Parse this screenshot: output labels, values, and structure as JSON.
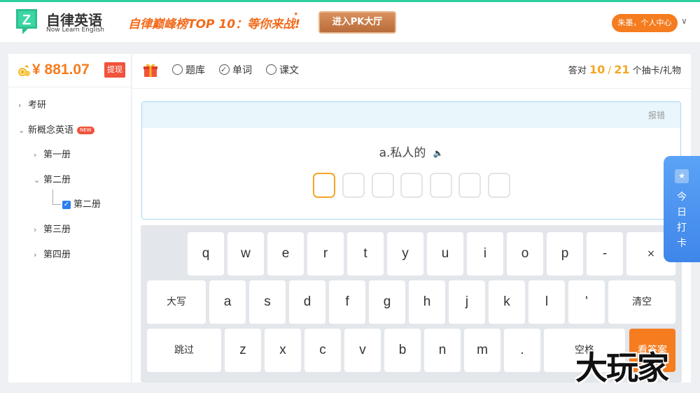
{
  "header": {
    "logo_letter": "Z",
    "logo_name": "自律英语",
    "logo_sub": "Now Learn English",
    "promo_text": "自律巅峰榜TOP 10：等你来战!",
    "promo_spark": "✦",
    "pk_button": "进入PK大厅",
    "user_button": "朱墨，个人中心",
    "user_arrow": "∨"
  },
  "sidebar": {
    "currency": "¥",
    "balance": "881.07",
    "withdraw": "提现",
    "tree": [
      {
        "label": "考研",
        "arrow": "›"
      },
      {
        "label": "新概念英语",
        "arrow": "⌄",
        "badge": "NEW"
      },
      {
        "label": "第一册",
        "arrow": "›"
      },
      {
        "label": "第二册",
        "arrow": "⌄"
      },
      {
        "label": "第二册",
        "checked": true
      },
      {
        "label": "第三册",
        "arrow": "›"
      },
      {
        "label": "第四册",
        "arrow": "›"
      }
    ]
  },
  "toolbar": {
    "options": [
      {
        "label": "题库",
        "checked": false
      },
      {
        "label": "单词",
        "checked": true
      },
      {
        "label": "课文",
        "checked": false
      }
    ],
    "score_prefix": "答对",
    "correct": "10",
    "separator": "/",
    "total": "21",
    "score_suffix": "个抽卡/礼物"
  },
  "question": {
    "report": "报错",
    "prompt": "a.私人的",
    "speaker": "🔈",
    "slot_count": 7
  },
  "keyboard": {
    "row1": [
      "q",
      "w",
      "e",
      "r",
      "t",
      "y",
      "u",
      "i",
      "o",
      "p",
      "-",
      "×"
    ],
    "row2": [
      "大写",
      "a",
      "s",
      "d",
      "f",
      "g",
      "h",
      "j",
      "k",
      "l",
      "'",
      "清空"
    ],
    "row3": [
      "跳过",
      "z",
      "x",
      "c",
      "v",
      "b",
      "n",
      "m",
      ".",
      "空格",
      "看答案"
    ]
  },
  "checkin": {
    "star": "★",
    "label_lines": [
      "今",
      "日",
      "打",
      "卡"
    ]
  },
  "watermark": "大玩家",
  "colors": {
    "accent_orange": "#f57c1f",
    "accent_green": "#2fcf9f",
    "accent_blue": "#3f86ea",
    "badge_red": "#f0533b",
    "score_gold": "#f5a623"
  }
}
